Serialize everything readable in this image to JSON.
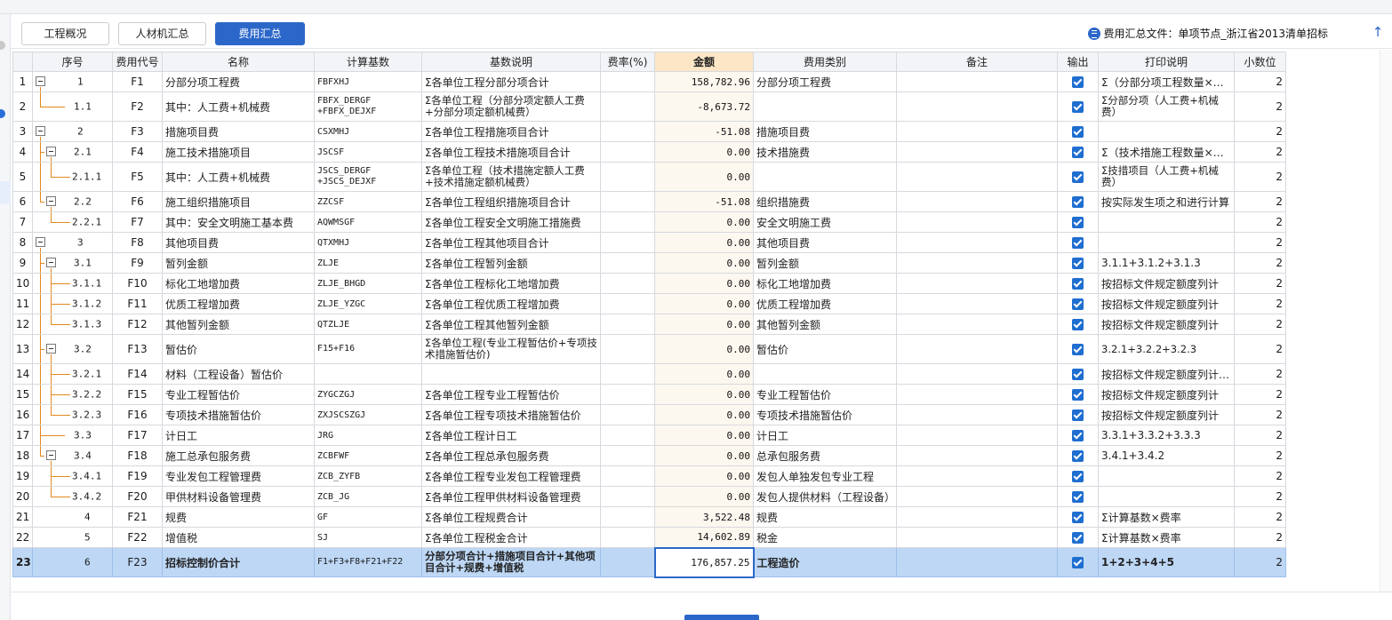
{
  "tabs": [
    {
      "label": "工程概况",
      "active": false
    },
    {
      "label": "人材机汇总",
      "active": false
    },
    {
      "label": "费用汇总",
      "active": true
    }
  ],
  "file_info": "费用汇总文件：单项节点_浙江省2013清单招标",
  "columns": {
    "rownum": "",
    "seq": "序号",
    "code": "费用代号",
    "name": "名称",
    "base": "计算基数",
    "desc": "基数说明",
    "rate": "费率(%)",
    "amount": "金额",
    "category": "费用类别",
    "remark": "备注",
    "output": "输出",
    "print": "打印说明",
    "decimals": "小数位"
  },
  "rows": [
    {
      "n": "1",
      "seq": "1",
      "level": 0,
      "box": true,
      "code": "F1",
      "name": "分部分项工程费",
      "base": "FBFXHJ",
      "desc": "Σ各单位工程分部分项合计",
      "rate": "",
      "amount": "158,782.96",
      "category": "分部分项工程费",
      "remark": "",
      "print": "Σ（分部分项工程数量×…",
      "dec": "2"
    },
    {
      "n": "2",
      "seq": "1.1",
      "level": 1,
      "last": true,
      "code": "F2",
      "name": "其中：人工费+机械费",
      "base": "FBFX_DERGF +FBFX_DEJXF",
      "desc": "Σ各单位工程（分部分项定额人工费+分部分项定额机械费）",
      "rate": "",
      "amount": "-8,673.72",
      "category": "",
      "remark": "",
      "print": "Σ分部分项（人工费+机械费）",
      "dec": "2",
      "tall": true
    },
    {
      "n": "3",
      "seq": "2",
      "level": 0,
      "box": true,
      "code": "F3",
      "name": "措施项目费",
      "base": "CSXMHJ",
      "desc": "Σ各单位工程措施项目合计",
      "rate": "",
      "amount": "-51.08",
      "category": "措施项目费",
      "remark": "",
      "print": "",
      "dec": "2"
    },
    {
      "n": "4",
      "seq": "2.1",
      "level": 1,
      "box": true,
      "code": "F4",
      "name": "施工技术措施项目",
      "base": "JSCSF",
      "desc": "Σ各单位工程技术措施项目合计",
      "rate": "",
      "amount": "0.00",
      "category": "技术措施费",
      "remark": "",
      "print": "Σ（技术措施工程数量×…",
      "dec": "2"
    },
    {
      "n": "5",
      "seq": "2.1.1",
      "level": 2,
      "last": true,
      "code": "F5",
      "name": "其中：人工费+机械费",
      "base": "JSCS_DERGF +JSCS_DEJXF",
      "desc": "Σ各单位工程（技术措施定额人工费+技术措施定额机械费）",
      "rate": "",
      "amount": "0.00",
      "category": "",
      "remark": "",
      "print": "Σ技措项目（人工费+机械费）",
      "dec": "2",
      "tall": true
    },
    {
      "n": "6",
      "seq": "2.2",
      "level": 1,
      "box": true,
      "last": true,
      "code": "F6",
      "name": "施工组织措施项目",
      "base": "ZZCSF",
      "desc": "Σ各单位工程组织措施项目合计",
      "rate": "",
      "amount": "-51.08",
      "category": "组织措施费",
      "remark": "",
      "print": "按实际发生项之和进行计算",
      "dec": "2"
    },
    {
      "n": "7",
      "seq": "2.2.1",
      "level": 2,
      "last": true,
      "code": "F7",
      "name": "其中：安全文明施工基本费",
      "base": "AQWMSGF",
      "desc": "Σ各单位工程安全文明施工措施费",
      "rate": "",
      "amount": "0.00",
      "category": "安全文明施工费",
      "remark": "",
      "print": "",
      "dec": "2"
    },
    {
      "n": "8",
      "seq": "3",
      "level": 0,
      "box": true,
      "code": "F8",
      "name": "其他项目费",
      "base": "QTXMHJ",
      "desc": "Σ各单位工程其他项目合计",
      "rate": "",
      "amount": "0.00",
      "category": "其他项目费",
      "remark": "",
      "print": "",
      "dec": "2"
    },
    {
      "n": "9",
      "seq": "3.1",
      "level": 1,
      "box": true,
      "code": "F9",
      "name": "暂列金额",
      "base": "ZLJE",
      "desc": "Σ各单位工程暂列金额",
      "rate": "",
      "amount": "0.00",
      "category": "暂列金额",
      "remark": "",
      "print": "3.1.1+3.1.2+3.1.3",
      "dec": "2"
    },
    {
      "n": "10",
      "seq": "3.1.1",
      "level": 2,
      "code": "F10",
      "name": "标化工地增加费",
      "base": "ZLJE_BHGD",
      "desc": "Σ各单位工程标化工地增加费",
      "rate": "",
      "amount": "0.00",
      "category": "标化工地增加费",
      "remark": "",
      "print": "按招标文件规定额度列计",
      "dec": "2"
    },
    {
      "n": "11",
      "seq": "3.1.2",
      "level": 2,
      "code": "F11",
      "name": "优质工程增加费",
      "base": "ZLJE_YZGC",
      "desc": "Σ各单位工程优质工程增加费",
      "rate": "",
      "amount": "0.00",
      "category": "优质工程增加费",
      "remark": "",
      "print": "按招标文件规定额度列计",
      "dec": "2"
    },
    {
      "n": "12",
      "seq": "3.1.3",
      "level": 2,
      "last": true,
      "code": "F12",
      "name": "其他暂列金额",
      "base": "QTZLJE",
      "desc": "Σ各单位工程其他暂列金额",
      "rate": "",
      "amount": "0.00",
      "category": "其他暂列金额",
      "remark": "",
      "print": "按招标文件规定额度列计",
      "dec": "2"
    },
    {
      "n": "13",
      "seq": "3.2",
      "level": 1,
      "box": true,
      "code": "F13",
      "name": "暂估价",
      "base": "F15+F16",
      "desc": "Σ各单位工程(专业工程暂估价+专项技术措施暂估价)",
      "rate": "",
      "amount": "0.00",
      "category": "暂估价",
      "remark": "",
      "print": "3.2.1+3.2.2+3.2.3",
      "dec": "2",
      "tall": true
    },
    {
      "n": "14",
      "seq": "3.2.1",
      "level": 2,
      "code": "F14",
      "name": "材料（工程设备）暂估价",
      "base": "",
      "desc": "",
      "rate": "",
      "amount": "0.00",
      "category": "",
      "remark": "",
      "print": "按招标文件规定额度列计…",
      "dec": "2"
    },
    {
      "n": "15",
      "seq": "3.2.2",
      "level": 2,
      "code": "F15",
      "name": "专业工程暂估价",
      "base": "ZYGCZGJ",
      "desc": "Σ各单位工程专业工程暂估价",
      "rate": "",
      "amount": "0.00",
      "category": "专业工程暂估价",
      "remark": "",
      "print": "按招标文件规定额度列计",
      "dec": "2"
    },
    {
      "n": "16",
      "seq": "3.2.3",
      "level": 2,
      "last": true,
      "code": "F16",
      "name": "专项技术措施暂估价",
      "base": "ZXJSCSZGJ",
      "desc": "Σ各单位工程专项技术措施暂估价",
      "rate": "",
      "amount": "0.00",
      "category": "专项技术措施暂估价",
      "remark": "",
      "print": "按招标文件规定额度列计",
      "dec": "2"
    },
    {
      "n": "17",
      "seq": "3.3",
      "level": 1,
      "code": "F17",
      "name": "计日工",
      "base": "JRG",
      "desc": "Σ各单位工程计日工",
      "rate": "",
      "amount": "0.00",
      "category": "计日工",
      "remark": "",
      "print": "3.3.1+3.3.2+3.3.3",
      "dec": "2"
    },
    {
      "n": "18",
      "seq": "3.4",
      "level": 1,
      "box": true,
      "last": true,
      "code": "F18",
      "name": "施工总承包服务费",
      "base": "ZCBFWF",
      "desc": "Σ各单位工程总承包服务费",
      "rate": "",
      "amount": "0.00",
      "category": "总承包服务费",
      "remark": "",
      "print": "3.4.1+3.4.2",
      "dec": "2"
    },
    {
      "n": "19",
      "seq": "3.4.1",
      "level": 2,
      "code": "F19",
      "name": "专业发包工程管理费",
      "base": "ZCB_ZYFB",
      "desc": "Σ各单位工程专业发包工程管理费",
      "rate": "",
      "amount": "0.00",
      "category": "发包人单独发包专业工程",
      "remark": "",
      "print": "",
      "dec": "2"
    },
    {
      "n": "20",
      "seq": "3.4.2",
      "level": 2,
      "last": true,
      "code": "F20",
      "name": "甲供材料设备管理费",
      "base": "ZCB_JG",
      "desc": "Σ各单位工程甲供材料设备管理费",
      "rate": "",
      "amount": "0.00",
      "category": "发包人提供材料（工程设备）",
      "remark": "",
      "print": "",
      "dec": "2"
    },
    {
      "n": "21",
      "seq": "4",
      "level": 0,
      "code": "F21",
      "name": "规费",
      "base": "GF",
      "desc": "Σ各单位工程规费合计",
      "rate": "",
      "amount": "3,522.48",
      "category": "规费",
      "remark": "",
      "print": "Σ计算基数×费率",
      "dec": "2"
    },
    {
      "n": "22",
      "seq": "5",
      "level": 0,
      "code": "F22",
      "name": "增值税",
      "base": "SJ",
      "desc": "Σ各单位工程税金合计",
      "rate": "",
      "amount": "14,602.89",
      "category": "税金",
      "remark": "",
      "print": "Σ计算基数×费率",
      "dec": "2"
    },
    {
      "n": "23",
      "seq": "6",
      "level": 0,
      "code": "F23",
      "name": "招标控制价合计",
      "base": "F1+F3+F8+F21+F22",
      "desc": "分部分项合计+措施项目合计+其他项目合计+规费+增值税",
      "rate": "",
      "amount": "176,857.25",
      "category": "工程造价",
      "remark": "",
      "print": "1+2+3+4+5",
      "dec": "2",
      "tall": true,
      "selected": true
    }
  ],
  "colors": {
    "accent": "#2b67c9",
    "tree_line": "#e0891f",
    "amount_header": "#fce6c5",
    "selection": "#bdd7f5"
  },
  "icons": {
    "file": "document-icon",
    "scroll_up": "arrow-up-icon",
    "checkbox": "checkbox-checked-icon",
    "expand": "collapse-box-icon"
  }
}
